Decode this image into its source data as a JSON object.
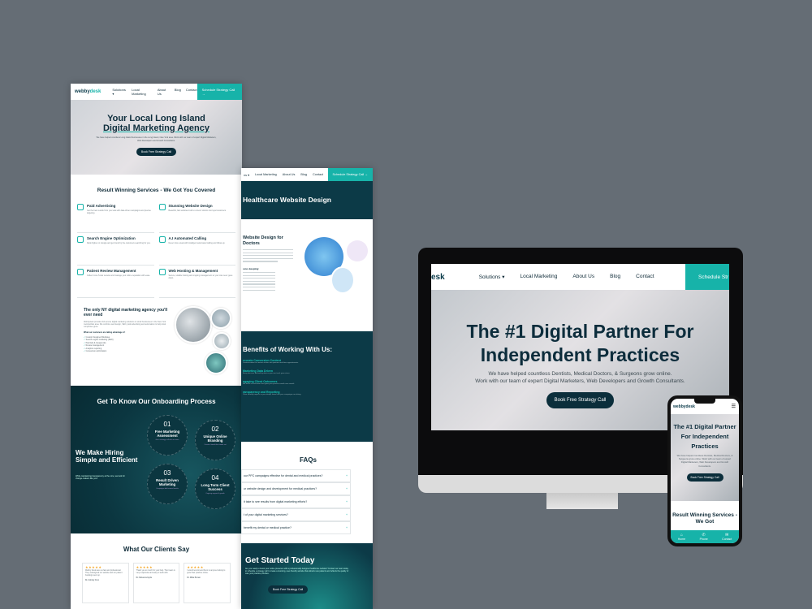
{
  "pageA": {
    "nav": {
      "logo_a": "webby",
      "logo_b": "desk",
      "links": [
        "Solutions ▾",
        "Local Marketing",
        "About Us",
        "Blog",
        "Contact"
      ],
      "cta": "Schedule Strategy Call →"
    },
    "hero": {
      "title_1": "Your Local Long Island",
      "title_2": "Digital Marketing Agency",
      "subtitle": "We have helped countless Long Island businesses in the Long Island, New York area. Work with our team of expert Digital Marketers, Web Developers and Growth Consultants.",
      "button": "Book Free Strategy Call"
    },
    "services": {
      "title": "Result Winning Services - We Got You Covered",
      "items": [
        {
          "title": "Paid Advertising",
          "desc": "Get the best results from your ads with data-driven campaigns and precise targeting."
        },
        {
          "title": "Stunning Website Design",
          "desc": "Beautiful, fast websites built to convert visitors into loyal customers."
        },
        {
          "title": "Search Engine Optimization",
          "desc": "Rank higher on Google and get found by the customers searching for you."
        },
        {
          "title": "A.I Automated Calling",
          "desc": "Never miss a lead with intelligent automated calling and follow-up."
        },
        {
          "title": "Patient Review Management",
          "desc": "Collect more 5-star reviews and manage your online reputation with ease."
        },
        {
          "title": "Web Hosting & Management",
          "desc": "Secure, reliable hosting and ongoing management so your site never goes down."
        }
      ]
    },
    "ny": {
      "title": "The only NY digital marketing agency you'll ever need",
      "body": "Webbydesk provides full-service digital marketing solutions to small businesses in the New York metropolitan area. We combine web design, SEO, paid advertising and automation to help local companies grow.",
      "list_title": "What our customers are taking advantage of:",
      "list": [
        "Custom Designed Websites",
        "Search engine marketing (SEO)",
        "Paid Ads & Google Ads",
        "Review management",
        "Analytics reporting",
        "Conversion optimization"
      ]
    },
    "onboarding": {
      "title": "Get To Know Our Onboarding Process",
      "hire_title": "We Make Hiring Simple and Efficient",
      "hire_sub": "While maintaining transparency at the core, we look for change-makers like you!",
      "steps": [
        {
          "num": "01",
          "title": "Free Marketing Assessment",
          "desc": "Get a strategy call with our team"
        },
        {
          "num": "02",
          "title": "Unique Online Branding",
          "desc": "Create a brand that stands out"
        },
        {
          "num": "03",
          "title": "Result Driven Marketing",
          "desc": "Campaigns built around results"
        },
        {
          "num": "04",
          "title": "Long Term Client Success",
          "desc": "Ongoing support & growth"
        }
      ]
    },
    "clients": {
      "title": "What Our Clients Say",
      "cards": [
        {
          "stars": "★★★★★",
          "text": "Webby Desk were so fast and professional. They redesigned our website and our patient bookings went up.",
          "name": "Dr. Ashley Cruz"
        },
        {
          "stars": "★★★★★",
          "text": "Thank you so much for your help. Their team is very responsive and easy to work with.",
          "name": "Dr. Rebecca Hyde"
        },
        {
          "stars": "★★★★★",
          "text": "I would recommend them to anyone looking to grow their practice online.",
          "name": "Dr. Mike Brown"
        }
      ]
    }
  },
  "pageB": {
    "nav": {
      "links": [
        "ns ▾",
        "Local Marketing",
        "About Us",
        "Blog",
        "Contact"
      ],
      "cta": "Schedule Strategy Call →"
    },
    "hero_title": "Healthcare Website Design",
    "web": {
      "title": "Website Design for Doctors",
      "list_title": "ocus keeping:"
    },
    "benefits": {
      "title": "Benefits of Working With Us:",
      "items": [
        {
          "title": "ecurate Conversion Content",
          "desc": "Content written to convert visitors into patients and drive appointments."
        },
        {
          "title": "Marketing Data Driven",
          "desc": "Every decision backed by data so you can track your return."
        },
        {
          "title": "ngaging Client Outcomes",
          "desc": "We focus on outcomes that grow your practice month over month."
        },
        {
          "title": "ransparency and Reporting",
          "desc": "Clear monthly reports so you always know how your campaigns are doing."
        }
      ]
    },
    "faq": {
      "title": "FAQs",
      "items": [
        "our PPC campaigns effective for dental and medical practices?",
        "ur website design and development for medical practices?",
        "it take to see results from digital marketing efforts?",
        "t of your digital marketing services?",
        "benefit my dental or medical practice?"
      ]
    },
    "get_started": {
      "title": "Get Started Today",
      "body": "Are you ready to boost your online presence with a professionally designed healthcare website? Contact our team today to schedule a strategy call to create a stunning, user-friendly website that attracts new patients and reflects the quality of care your practice provides.",
      "button": "Book Free Strategy Call"
    }
  },
  "monitor": {
    "nav": {
      "logo": "esk",
      "links": [
        "Solutions ▾",
        "Local Marketing",
        "About Us",
        "Blog",
        "Contact"
      ],
      "cta": "Schedule Str"
    },
    "hero": {
      "title_1": "The #1 Digital Partner For",
      "title_2": "Independent Practices",
      "sub_1": "We have helped countless Dentists, Medical Doctors, & Surgeons grow online.",
      "sub_2": "Work with our team of expert Digital Marketers, Web Developers and Growth Consultants.",
      "button": "Book Free Strategy Call"
    }
  },
  "phone": {
    "logo": "webbydesk",
    "hero": {
      "title": "The #1 Digital Partner For Independent Practices",
      "sub": "We have helped countless Dentists, Medical Doctors, & Surgeons grow online. Work with our team of expert Digital Marketers, Web Developers and Growth Consultants.",
      "button": "Book Free Strategy Call"
    },
    "services_title": "Result Winning Services - We Got",
    "bar": [
      {
        "icon": "⌂",
        "label": "Home"
      },
      {
        "icon": "✆",
        "label": "Phone"
      },
      {
        "icon": "✉",
        "label": "Contact"
      }
    ]
  },
  "colors": {
    "teal": "#17b3a9",
    "navy": "#0c3a47",
    "background": "#656d75"
  }
}
